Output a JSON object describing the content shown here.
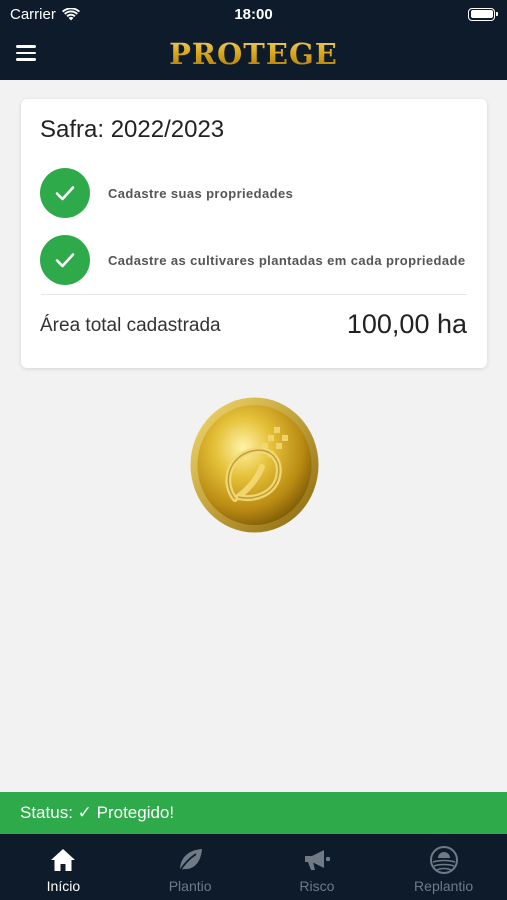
{
  "status_bar": {
    "carrier": "Carrier",
    "time": "18:00"
  },
  "header": {
    "logo_text": "PROTEGE",
    "menu_icon": "hamburger-menu-icon"
  },
  "summary_card": {
    "season_title": "Safra: 2022/2023",
    "steps": [
      {
        "label": "Cadastre suas propriedades",
        "completed": true
      },
      {
        "label": "Cadastre as cultivares plantadas em cada propriedade",
        "completed": true
      }
    ],
    "area_label": "Área total cadastrada",
    "area_value": "100,00 ha"
  },
  "status": {
    "text": "Status: ✓ Protegido!",
    "color": "#2eaa4a"
  },
  "tabs": [
    {
      "label": "Início",
      "icon": "home-icon",
      "active": true
    },
    {
      "label": "Plantio",
      "icon": "leaf-icon",
      "active": false
    },
    {
      "label": "Risco",
      "icon": "megaphone-icon",
      "active": false
    },
    {
      "label": "Replantio",
      "icon": "field-sun-icon",
      "active": false
    }
  ],
  "colors": {
    "navy": "#0d1b2a",
    "green": "#2eaa4a",
    "gold": "#d7a51a",
    "inactive_tab": "#6f7a86"
  }
}
